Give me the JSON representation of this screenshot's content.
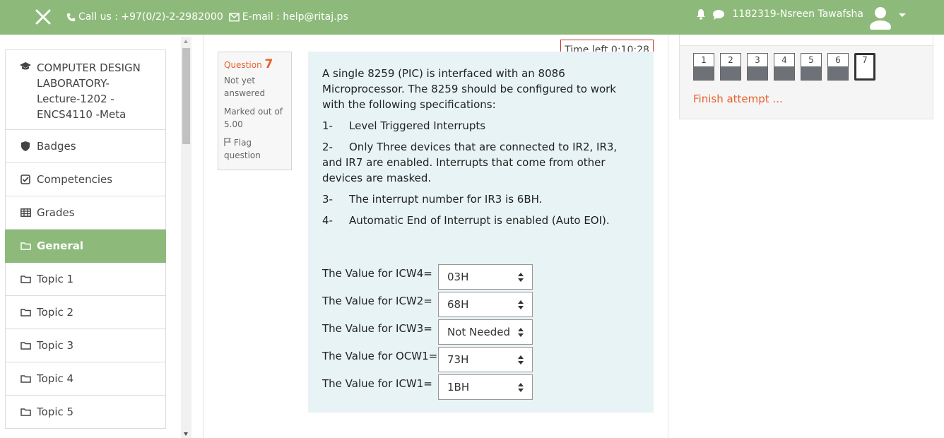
{
  "header": {
    "contact_phone": "Call us : +97(0/2)-2-2982000",
    "contact_email": "E-mail : help@ritaj.ps",
    "user_name": "1182319-Nsreen Tawafsha",
    "colors": {
      "bar": "#8dba7a"
    }
  },
  "sidebar": {
    "course": [
      "COMPUTER DESIGN",
      "LABORATORY-",
      "Lecture-1202 -",
      "ENCS4110 -Meta"
    ],
    "items": [
      {
        "label": "Badges",
        "icon": "shield-icon"
      },
      {
        "label": "Competencies",
        "icon": "checkbox-icon"
      },
      {
        "label": "Grades",
        "icon": "table-icon"
      },
      {
        "label": "General",
        "icon": "folder-icon",
        "active": true
      },
      {
        "label": "Topic 1",
        "icon": "folder-icon"
      },
      {
        "label": "Topic 2",
        "icon": "folder-icon"
      },
      {
        "label": "Topic 3",
        "icon": "folder-icon"
      },
      {
        "label": "Topic 4",
        "icon": "folder-icon"
      },
      {
        "label": "Topic 5",
        "icon": "folder-icon"
      }
    ]
  },
  "timer": {
    "label": "Time left 0:10:28"
  },
  "question_info": {
    "question_label": "Question",
    "question_number": "7",
    "state_line1": "Not yet",
    "state_line2": "answered",
    "marked_line1": "Marked out of",
    "marked_line2": "5.00",
    "flag_line1": "Flag",
    "flag_line2": "question"
  },
  "question": {
    "intro": "A single 8259 (PIC) is interfaced with an 8086 Microprocessor. The 8259 should be configured to work with the following specifications:",
    "specs": [
      {
        "num": "1-",
        "text": "Level Triggered Interrupts"
      },
      {
        "num": "2-",
        "text": "Only Three devices that are connected to IR2, IR3, and IR7 are enabled. Interrupts that come from other devices are masked."
      },
      {
        "num": "3-",
        "text": "The interrupt number for IR3 is 6BH."
      },
      {
        "num": "4-",
        "text": "Automatic End of Interrupt is enabled (Auto EOI)."
      }
    ],
    "answers": [
      {
        "label": "The Value for ICW4=",
        "value": "03H"
      },
      {
        "label": "The Value for ICW2=",
        "value": "68H"
      },
      {
        "label": "The Value for ICW3=",
        "value": "Not Needed"
      },
      {
        "label": "The Value for OCW1=",
        "value": "73H"
      },
      {
        "label": "The Value for ICW1=",
        "value": "1BH"
      }
    ]
  },
  "quiz_nav": {
    "questions": [
      "1",
      "2",
      "3",
      "4",
      "5",
      "6",
      "7"
    ],
    "current": "7",
    "finish_label": "Finish attempt ..."
  }
}
